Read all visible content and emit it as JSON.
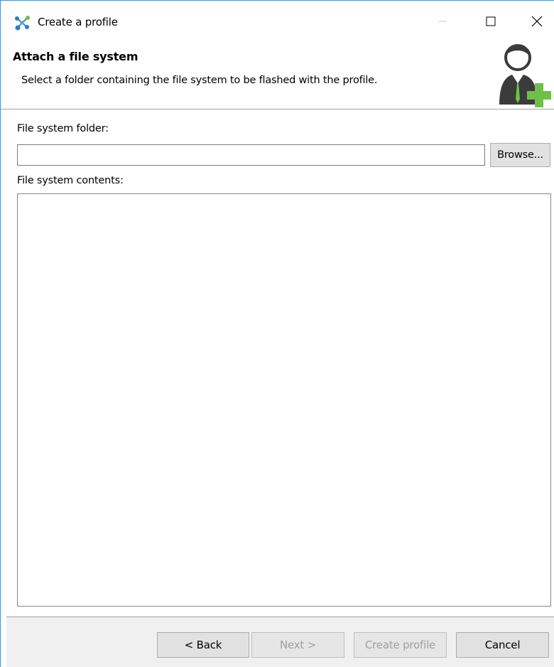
{
  "window": {
    "title": "Create a profile",
    "app_icon": "network-nodes-icon",
    "controls": {
      "minimize": "minimize-icon",
      "maximize": "maximize-icon",
      "close": "close-icon"
    }
  },
  "header": {
    "title": "Attach a file system",
    "description": "Select a folder containing the file system to be flashed with the profile.",
    "icon": "add-user-profile-icon",
    "accent_color": "#6fc04a"
  },
  "form": {
    "folder_label": "File system folder:",
    "folder_value": "",
    "browse_label": "Browse...",
    "contents_label": "File system contents:"
  },
  "buttons": {
    "back": "< Back",
    "next": "Next >",
    "create": "Create profile",
    "cancel": "Cancel"
  }
}
